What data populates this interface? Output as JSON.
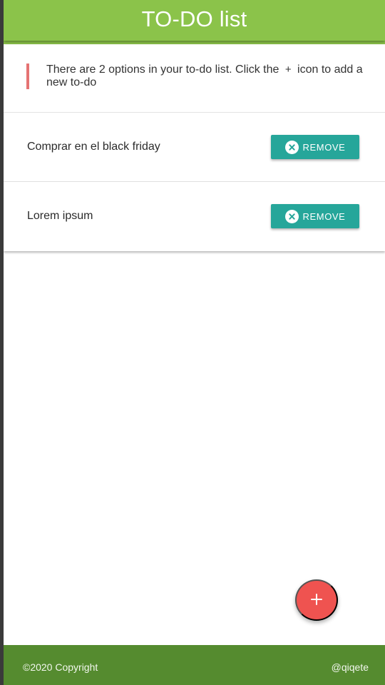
{
  "header": {
    "title": "TO-DO list"
  },
  "notice": {
    "text_before": "There are 2 options in your to-do list. Click the",
    "plus_glyph": "+",
    "text_after": "icon to add a new to-do",
    "accent_color": "#e57373"
  },
  "todos": [
    {
      "text": "Comprar en el black friday",
      "remove_label": "REMOVE",
      "remove_icon": "close-circle-icon"
    },
    {
      "text": "Lorem ipsum",
      "remove_label": "REMOVE",
      "remove_icon": "close-circle-icon"
    }
  ],
  "fab": {
    "icon": "plus-icon",
    "color": "#ef5350"
  },
  "footer": {
    "copyright": "©2020 Copyright",
    "handle": "@qiqete"
  },
  "colors": {
    "appbar": "#8bc34a",
    "button": "#26a69a",
    "footer": "#558b2f"
  }
}
